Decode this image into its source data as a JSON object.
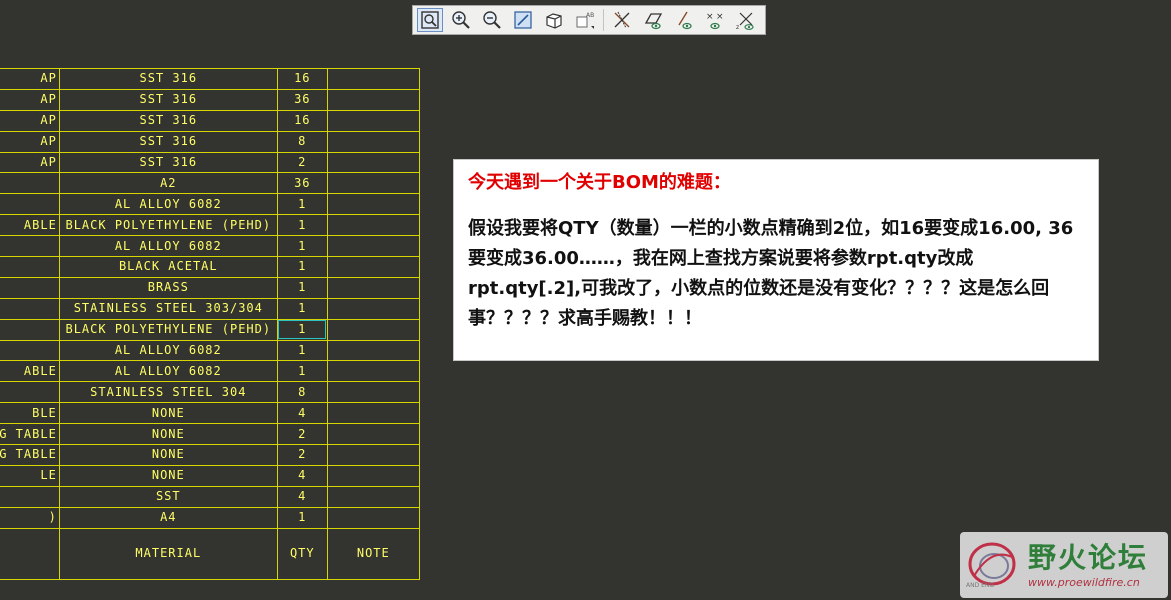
{
  "toolbar": {
    "buttons": [
      {
        "name": "zoom-fit-icon"
      },
      {
        "name": "zoom-in-icon"
      },
      {
        "name": "zoom-out-icon"
      },
      {
        "name": "repaint-icon"
      },
      {
        "name": "view-cube-icon"
      },
      {
        "name": "annotation-display-icon"
      },
      {
        "name": "datum-axis-icon"
      },
      {
        "name": "datum-plane-icon"
      },
      {
        "name": "datum-axis-display-icon"
      },
      {
        "name": "point-display-icon"
      },
      {
        "name": "csys-display-icon"
      }
    ]
  },
  "bom": {
    "rows": [
      {
        "desc": "AP",
        "material": "SST 316",
        "qty": "16",
        "note": ""
      },
      {
        "desc": "AP",
        "material": "SST 316",
        "qty": "36",
        "note": ""
      },
      {
        "desc": "AP",
        "material": "SST 316",
        "qty": "16",
        "note": ""
      },
      {
        "desc": "AP",
        "material": "SST 316",
        "qty": "8",
        "note": ""
      },
      {
        "desc": "AP",
        "material": "SST 316",
        "qty": "2",
        "note": ""
      },
      {
        "desc": "",
        "material": "A2",
        "qty": "36",
        "note": ""
      },
      {
        "desc": "",
        "material": "AL ALLOY 6082",
        "qty": "1",
        "note": ""
      },
      {
        "desc": "ABLE",
        "material": "BLACK POLYETHYLENE (PEHD)",
        "qty": "1",
        "note": ""
      },
      {
        "desc": "",
        "material": "AL ALLOY 6082",
        "qty": "1",
        "note": ""
      },
      {
        "desc": "",
        "material": "BLACK ACETAL",
        "qty": "1",
        "note": ""
      },
      {
        "desc": "",
        "material": "BRASS",
        "qty": "1",
        "note": ""
      },
      {
        "desc": "",
        "material": "STAINLESS STEEL 303/304",
        "qty": "1",
        "note": ""
      },
      {
        "desc": "",
        "material": "BLACK POLYETHYLENE (PEHD)",
        "qty": "1",
        "note": ""
      },
      {
        "desc": "",
        "material": "AL ALLOY 6082",
        "qty": "1",
        "note": ""
      },
      {
        "desc": "ABLE",
        "material": "AL ALLOY 6082",
        "qty": "1",
        "note": ""
      },
      {
        "desc": "",
        "material": "STAINLESS STEEL 304",
        "qty": "8",
        "note": ""
      },
      {
        "desc": "BLE",
        "material": "NONE",
        "qty": "4",
        "note": ""
      },
      {
        "desc": "NG TABLE",
        "material": "NONE",
        "qty": "2",
        "note": ""
      },
      {
        "desc": "G TABLE",
        "material": "NONE",
        "qty": "2",
        "note": ""
      },
      {
        "desc": "LE",
        "material": "NONE",
        "qty": "4",
        "note": ""
      },
      {
        "desc": "",
        "material": "SST",
        "qty": "4",
        "note": ""
      },
      {
        "desc": ")",
        "material": "A4",
        "qty": "1",
        "note": ""
      }
    ],
    "header": {
      "material": "MATERIAL",
      "qty": "QTY",
      "note": "NOTE"
    }
  },
  "note": {
    "title": "今天遇到一个关于BOM的难题：",
    "body": "假设我要将QTY（数量）一栏的小数点精确到2位，如16要变成16.00, 36要变成36.00……，我在网上查找方案说要将参数rpt.qty改成rpt.qty[.2],可我改了，小数点的位数还是没有变化？？？？这是怎么回事？？？？求高手赐教！！！"
  },
  "watermark": {
    "name": "野火论坛",
    "url": "www.proewildfire.cn",
    "small": "AND     ENG"
  },
  "colors": {
    "background": "#333330",
    "table_line": "#d7d700",
    "table_text": "#ffff66",
    "selection": "#2ec4c4",
    "title_red": "#e00000"
  }
}
